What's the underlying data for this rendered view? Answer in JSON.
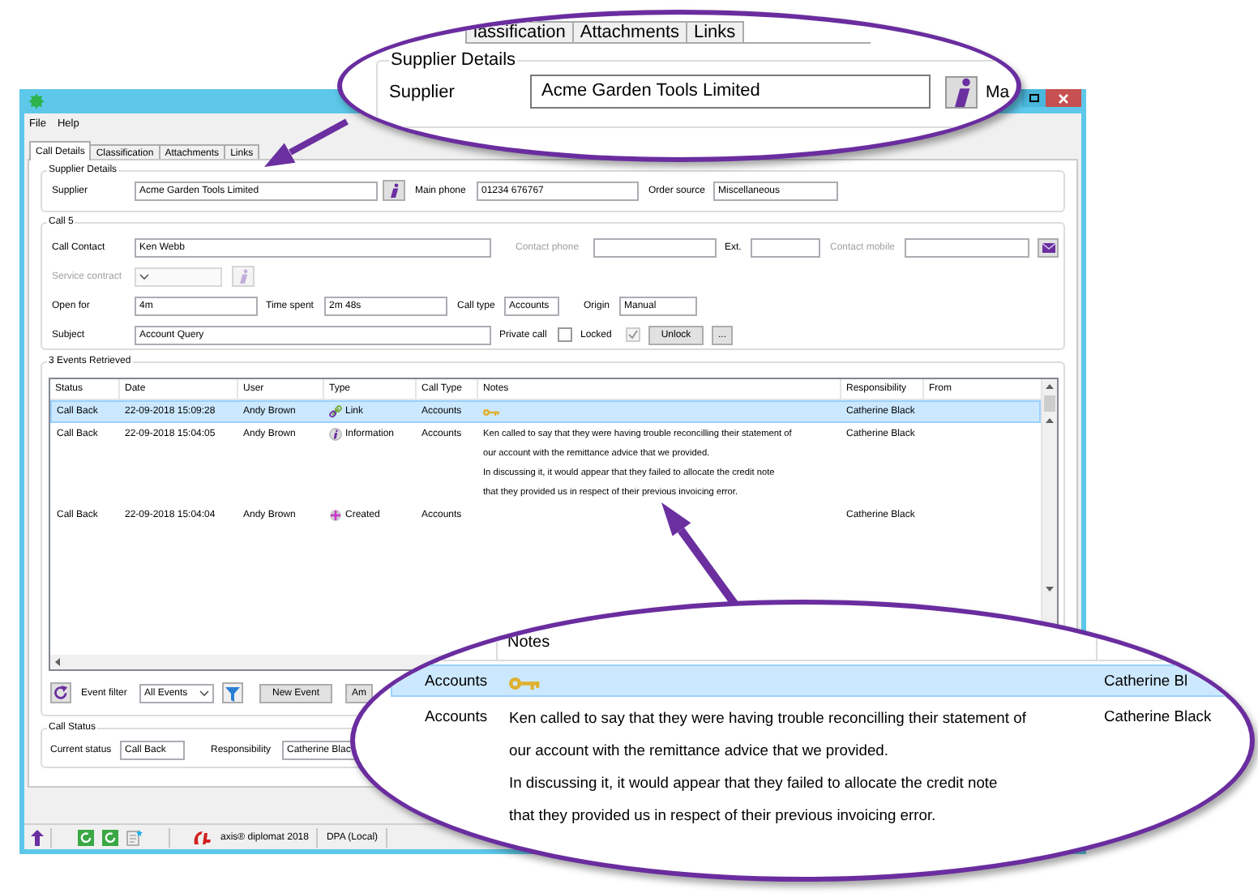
{
  "menu": [
    {
      "label": "File"
    },
    {
      "label": "Help"
    }
  ],
  "tabs": [
    {
      "label": "Call Details",
      "selected": true
    },
    {
      "label": "Classification",
      "selected": false
    },
    {
      "label": "Attachments",
      "selected": false
    },
    {
      "label": "Links",
      "selected": false
    }
  ],
  "supplier_details": {
    "title": "Supplier Details",
    "items": [
      {
        "kind": "label",
        "text": "Supplier",
        "disabled": false
      },
      {
        "kind": "field",
        "value": "Acme Garden Tools Limited",
        "disabled": false
      },
      {
        "kind": "info",
        "disabled": false
      },
      {
        "kind": "label",
        "text": "Main phone",
        "disabled": false
      },
      {
        "kind": "field",
        "value": "01234 676767",
        "disabled": false
      },
      {
        "kind": "label",
        "text": "Order source",
        "disabled": false
      },
      {
        "kind": "field",
        "value": "Miscellaneous",
        "disabled": false
      }
    ]
  },
  "call": {
    "title": "Call 5",
    "rows": [
      [
        {
          "kind": "label",
          "text": "Call Contact",
          "disabled": false
        },
        {
          "kind": "field",
          "value": "Ken Webb",
          "disabled": false
        },
        {
          "kind": "label",
          "text": "Contact phone",
          "disabled": true
        },
        {
          "kind": "field",
          "disabled": false
        },
        {
          "kind": "label",
          "text": "Ext.",
          "disabled": false
        },
        {
          "kind": "field",
          "disabled": false
        },
        {
          "kind": "label",
          "text": "Contact mobile",
          "disabled": true
        },
        {
          "kind": "field",
          "disabled": false
        },
        {
          "kind": "mail",
          "disabled": false
        }
      ],
      [
        {
          "kind": "label",
          "text": "Service contract",
          "disabled": true
        },
        {
          "kind": "dropdown",
          "disabled": true
        },
        {
          "kind": "info",
          "disabled": true
        }
      ],
      [
        {
          "kind": "label",
          "text": "Open for",
          "disabled": false
        },
        {
          "kind": "field",
          "value": "4m",
          "disabled": false
        },
        {
          "kind": "label",
          "text": "Time spent",
          "disabled": false
        },
        {
          "kind": "field",
          "value": "2m 48s",
          "disabled": false
        },
        {
          "kind": "label",
          "text": "Call type",
          "disabled": false
        },
        {
          "kind": "field",
          "value": "Accounts",
          "disabled": false
        },
        {
          "kind": "label",
          "text": "Origin",
          "disabled": false
        },
        {
          "kind": "field",
          "value": "Manual",
          "disabled": false
        }
      ],
      [
        {
          "kind": "label",
          "text": "Subject",
          "disabled": false
        },
        {
          "kind": "field",
          "value": "Account Query",
          "disabled": false
        },
        {
          "kind": "label",
          "text": "Private call",
          "disabled": false
        },
        {
          "kind": "checkbox",
          "checked": false,
          "disabled": false
        },
        {
          "kind": "label",
          "text": "Locked",
          "disabled": false
        },
        {
          "kind": "checkbox",
          "checked": true,
          "disabled": true
        },
        {
          "kind": "button",
          "label": "Unlock",
          "disabled": false
        },
        {
          "kind": "button",
          "label": "...",
          "disabled": false
        }
      ]
    ]
  },
  "events": {
    "title": "3 Events Retrieved",
    "columns": [
      "Status",
      "Date",
      "User",
      "Type",
      "Call Type",
      "Notes",
      "Responsibility",
      "From"
    ],
    "rows": [
      {
        "selected": true,
        "status": "Call Back",
        "date": "22-09-2018 15:09:28",
        "user": "Andy Brown",
        "type": {
          "kind": "link",
          "label": "Link"
        },
        "call_type": "Accounts",
        "keyed": true,
        "responsibility": "Catherine Black"
      },
      {
        "selected": false,
        "status": "Call Back",
        "date": "22-09-2018 15:04:05",
        "user": "Andy Brown",
        "type": {
          "kind": "information",
          "label": "Information"
        },
        "call_type": "Accounts",
        "keyed": false,
        "notes": [
          "Ken called to say that they were having trouble reconcilling their statement of",
          "our account with the remittance advice that we provided.",
          "In discussing it, it would appear that they failed to allocate the credit note",
          "that they provided us in respect of their previous invoicing error."
        ],
        "responsibility": "Catherine Black"
      },
      {
        "selected": false,
        "status": "Call Back",
        "date": "22-09-2018 15:04:04",
        "user": "Andy Brown",
        "type": {
          "kind": "created",
          "label": "Created"
        },
        "call_type": "Accounts",
        "keyed": false,
        "responsibility": "Catherine Black"
      }
    ],
    "toolbar": [
      {
        "kind": "refresh",
        "disabled": false
      },
      {
        "kind": "label",
        "text": "Event filter",
        "disabled": false
      },
      {
        "kind": "dropdown",
        "value": "All Events",
        "disabled": false
      },
      {
        "kind": "filter",
        "disabled": false
      },
      {
        "kind": "button",
        "label": "New Event",
        "disabled": false
      },
      {
        "kind": "button",
        "label": "Am",
        "disabled": false
      }
    ]
  },
  "call_status": {
    "title": "Call Status",
    "items": [
      {
        "kind": "label",
        "text": "Current status",
        "disabled": false
      },
      {
        "kind": "field",
        "value": "Call Back",
        "disabled": false
      },
      {
        "kind": "label",
        "text": "Responsibility",
        "disabled": false
      },
      {
        "kind": "field",
        "value": "Catherine Blac",
        "disabled": false
      }
    ]
  },
  "status_bar": {
    "product": "axis® diplomat 2018",
    "database": "DPA (Local)"
  },
  "top_callout": {
    "tabs": [
      {
        "label": "lassification",
        "selected": false
      },
      {
        "label": "Attachments",
        "selected": false
      },
      {
        "label": "Links",
        "selected": false
      }
    ],
    "group_title": "Supplier Details",
    "supplier_label": "Supplier",
    "supplier": "Acme Garden Tools Limited",
    "next_label": "Ma"
  },
  "bottom_callout": {
    "columns": [
      "Notes"
    ],
    "rows": [
      {
        "selected": true,
        "call_type": "Accounts",
        "keyed": true,
        "responsibility": "Catherine Bl"
      },
      {
        "selected": false,
        "call_type": "Accounts",
        "keyed": false,
        "notes": [
          "Ken called to say that they were having trouble reconcilling their statement of",
          "our account with the remittance advice that we provided.",
          "In discussing it, it would appear that they failed to allocate the credit note",
          "that they provided us in respect of their previous invoicing error."
        ],
        "responsibility": "Catherine Black"
      }
    ]
  }
}
